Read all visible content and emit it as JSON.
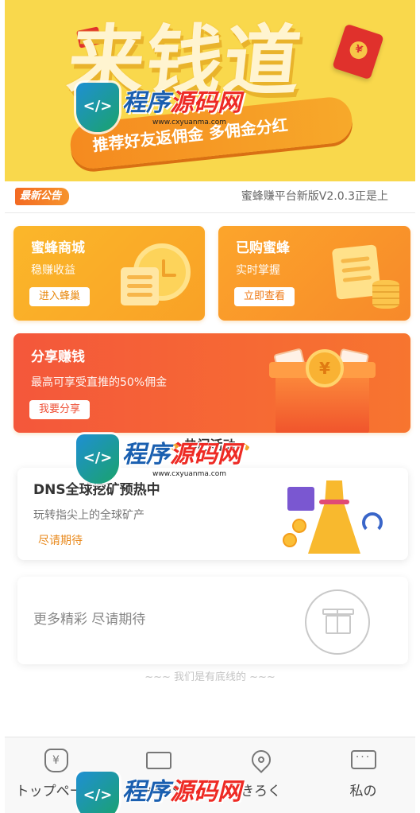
{
  "banner": {
    "title": "来钱道",
    "subtitle": "推荐好友返佣金 多佣金分红",
    "redpack_symbol": "¥"
  },
  "notice": {
    "badge": "最新公告",
    "text": "蜜蜂赚平台新版V2.0.3正是上"
  },
  "cards": {
    "mall": {
      "title": "蜜蜂商城",
      "subtitle": "稳赚收益",
      "button": "进入蜂巢"
    },
    "bought": {
      "title": "已购蜜蜂",
      "subtitle": "实时掌握",
      "button": "立即查看"
    },
    "share": {
      "title": "分享赚钱",
      "subtitle": "最高可享受直推的50%佣金",
      "button": "我要分享",
      "coin_symbol": "¥"
    }
  },
  "section": {
    "title": "热门活动"
  },
  "activity": {
    "title": "DNS全球挖矿预热中",
    "description": "玩转指尖上的全球矿产",
    "status": "尽请期待"
  },
  "more": {
    "text": "更多精彩 尽请期待"
  },
  "footer": {
    "bottom_line": "~~~ 我们是有底线的 ~~~"
  },
  "tabbar": {
    "items": [
      {
        "label": "トップページ",
        "icon": "money-bag-icon",
        "glyph": "¥"
      },
      {
        "label": "チャージ",
        "icon": "ticket-icon",
        "glyph": ""
      },
      {
        "label": "きろく",
        "icon": "location-pin-icon",
        "glyph": ""
      },
      {
        "label": "私の",
        "icon": "chat-bubble-icon",
        "glyph": "···"
      }
    ]
  },
  "watermark": {
    "brand_a": "程序",
    "brand_b": "源码网",
    "url": "www.cxyuanma.com",
    "shield_glyph": "</>"
  },
  "colors": {
    "banner_bg": "#f9d84c",
    "accent_orange": "#f7892a",
    "accent_red": "#f4573b",
    "status_orange": "#e98a1e"
  }
}
